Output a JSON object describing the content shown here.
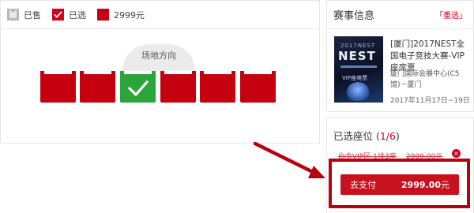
{
  "legend": {
    "sold_label": "已售",
    "selected_label": "已选",
    "price_label": "2999元"
  },
  "stage": {
    "label": "场地方向"
  },
  "seats": [
    {
      "state": "available"
    },
    {
      "state": "available"
    },
    {
      "state": "selected"
    },
    {
      "state": "available"
    },
    {
      "state": "available"
    },
    {
      "state": "available"
    }
  ],
  "event": {
    "section_title": "赛事信息",
    "reselect_label": "「重选」",
    "poster_year": "2017NEST",
    "poster_title": "NEST",
    "poster_tag": "VIP座席票",
    "name": "[厦门]2017NEST全国电子竞技大赛-VIP座席票",
    "venue": "厦门国际会展中心(C5馆)－厦门",
    "date": "2017年11月17日~19日"
  },
  "selection": {
    "title_prefix": "已选座位 (",
    "count": "1/6",
    "title_suffix": ")",
    "item_section": "白金VIP区 1排3座",
    "item_price": "2999.00元",
    "remove_icon": "×"
  },
  "pay": {
    "label": "去支付",
    "amount": "2999.00",
    "unit": "元"
  },
  "colors": {
    "accent": "#c9101f",
    "selected_seat": "#2ba43a",
    "sold": "#b9b9b9",
    "annotation": "#b8000f"
  }
}
